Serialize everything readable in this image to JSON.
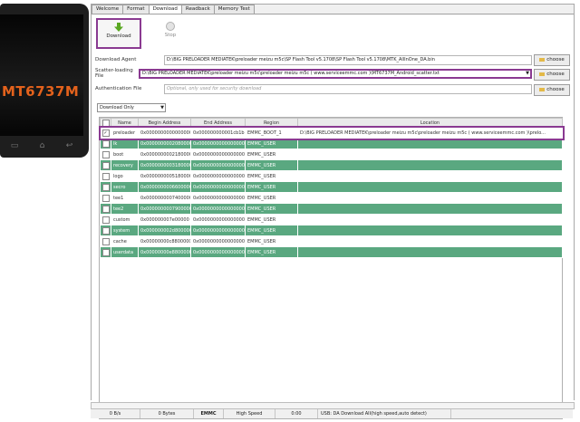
{
  "phone": {
    "model": "MT6737M"
  },
  "tabs": [
    "Welcome",
    "Format",
    "Download",
    "Readback",
    "Memory Test"
  ],
  "toolbar": {
    "download_label": "Download",
    "stop_label": "Stop"
  },
  "fields": {
    "download_agent": {
      "label": "Download Agent",
      "value": "D:\\BIG PRELOADER MEDIATEK\\preloader meizu m5c\\SP Flash Tool v5.1708\\SP Flash Tool v5.1708\\MTK_AllInOne_DA.bin"
    },
    "scatter": {
      "label": "Scatter-loading File",
      "value": "D:\\BIG PRELOADER MEDIATEK\\preloader meizu m5c\\preloader meizu m5c ( www.serviceemmc.com )\\MT6737M_Android_scatter.txt"
    },
    "auth": {
      "label": "Authentication File",
      "placeholder": "Optional, only used for security download"
    },
    "choose_label": "choose"
  },
  "mode": {
    "selected": "Download Only"
  },
  "table": {
    "headers": [
      "",
      "Name",
      "Begin Address",
      "End Address",
      "Region",
      "Location"
    ],
    "rows": [
      {
        "checked": true,
        "name": "preloader",
        "begin": "0x0000000000000000",
        "end": "0x000000000001cb1b",
        "region": "EMMC_BOOT_1",
        "location": "D:\\BIG PRELOADER MEDIATEK\\preloader meizu m5c\\preloader meizu m5c ( www.serviceemmc.com )\\prelo..."
      },
      {
        "checked": false,
        "name": "lk",
        "begin": "0x0000000002080000",
        "end": "0x0000000000000000",
        "region": "EMMC_USER",
        "location": ""
      },
      {
        "checked": false,
        "name": "boot",
        "begin": "0x0000000002180000",
        "end": "0x0000000000000000",
        "region": "EMMC_USER",
        "location": ""
      },
      {
        "checked": false,
        "name": "recovery",
        "begin": "0x0000000003180000",
        "end": "0x0000000000000000",
        "region": "EMMC_USER",
        "location": ""
      },
      {
        "checked": false,
        "name": "logo",
        "begin": "0x0000000005180000",
        "end": "0x0000000000000000",
        "region": "EMMC_USER",
        "location": ""
      },
      {
        "checked": false,
        "name": "secro",
        "begin": "0x0000000006600000",
        "end": "0x0000000000000000",
        "region": "EMMC_USER",
        "location": ""
      },
      {
        "checked": false,
        "name": "tee1",
        "begin": "0x0000000007400000",
        "end": "0x0000000000000000",
        "region": "EMMC_USER",
        "location": ""
      },
      {
        "checked": false,
        "name": "tee2",
        "begin": "0x0000000007900000",
        "end": "0x0000000000000000",
        "region": "EMMC_USER",
        "location": ""
      },
      {
        "checked": false,
        "name": "custom",
        "begin": "0x000000007e00000",
        "end": "0x0000000000000000",
        "region": "EMMC_USER",
        "location": ""
      },
      {
        "checked": false,
        "name": "system",
        "begin": "0x000000002d800000",
        "end": "0x0000000000000000",
        "region": "EMMC_USER",
        "location": ""
      },
      {
        "checked": false,
        "name": "cache",
        "begin": "0x00000000c8800000",
        "end": "0x0000000000000000",
        "region": "EMMC_USER",
        "location": ""
      },
      {
        "checked": false,
        "name": "userdata",
        "begin": "0x00000000e8800000",
        "end": "0x0000000000000000",
        "region": "EMMC_USER",
        "location": ""
      }
    ]
  },
  "status": {
    "speed": "0 B/s",
    "bytes": "0 Bytes",
    "storage": "EMMC",
    "mode": "High Speed",
    "time": "0:00",
    "usb": "USB: DA Download All(high speed,auto detect)"
  },
  "colors": {
    "row_green": "#5aa880",
    "highlight": "#8a3a91",
    "phone_text": "#e4621c"
  }
}
